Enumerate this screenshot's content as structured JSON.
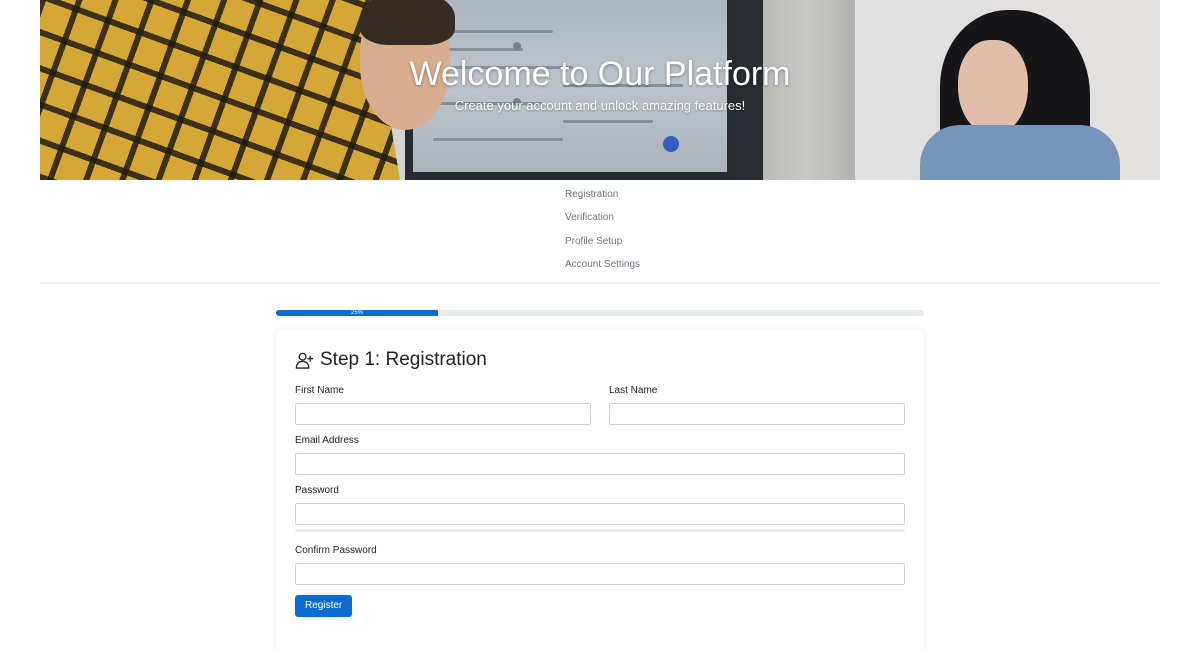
{
  "hero": {
    "title": "Welcome to Our Platform",
    "subtitle": "Create your account and unlock amazing features!"
  },
  "steps": [
    {
      "label": "Registration"
    },
    {
      "label": "Verification"
    },
    {
      "label": "Profile Setup"
    },
    {
      "label": "Account Settings"
    }
  ],
  "progress": {
    "value_percent": 25,
    "label": "25%",
    "color": "#0a6ed1"
  },
  "form": {
    "icon": "user-plus-icon",
    "title": "Step 1: Registration",
    "fields": {
      "first_name": {
        "label": "First Name",
        "value": ""
      },
      "last_name": {
        "label": "Last Name",
        "value": ""
      },
      "email": {
        "label": "Email Address",
        "value": ""
      },
      "password": {
        "label": "Password",
        "value": ""
      },
      "confirm_password": {
        "label": "Confirm Password",
        "value": ""
      }
    },
    "submit_label": "Register"
  }
}
